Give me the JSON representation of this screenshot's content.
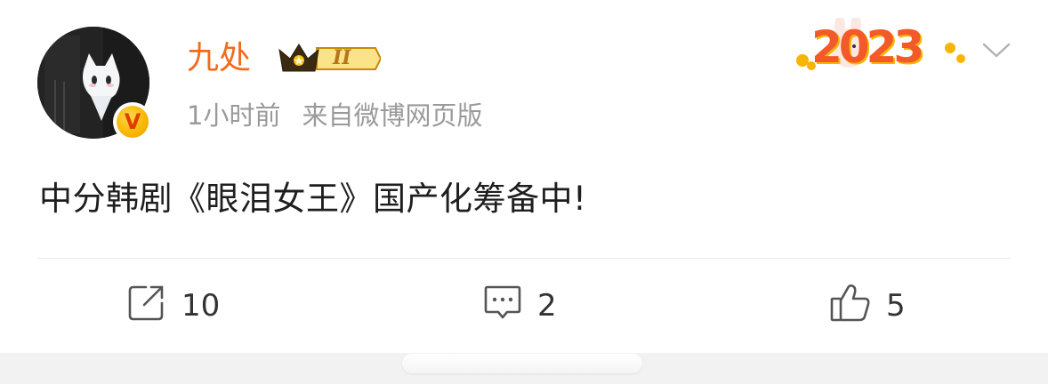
{
  "post": {
    "username": "九处",
    "timestamp": "1小时前",
    "source": "来自微博网页版",
    "content": "中分韩剧《眼泪女王》国产化筹备中!",
    "vip_level": "II",
    "festival_badge": "2023"
  },
  "actions": {
    "repost_count": "10",
    "comment_count": "2",
    "like_count": "5"
  },
  "icons": {
    "avatar": "avatar",
    "verified": "verified-badge-icon",
    "crown": "vip-crown-icon",
    "chevron": "chevron-down-icon",
    "repost": "repost-icon",
    "comment": "comment-icon",
    "like": "thumbs-up-icon"
  },
  "colors": {
    "username": "#f26b1d",
    "meta": "#9a9a9a",
    "verified": "#f7b500"
  }
}
